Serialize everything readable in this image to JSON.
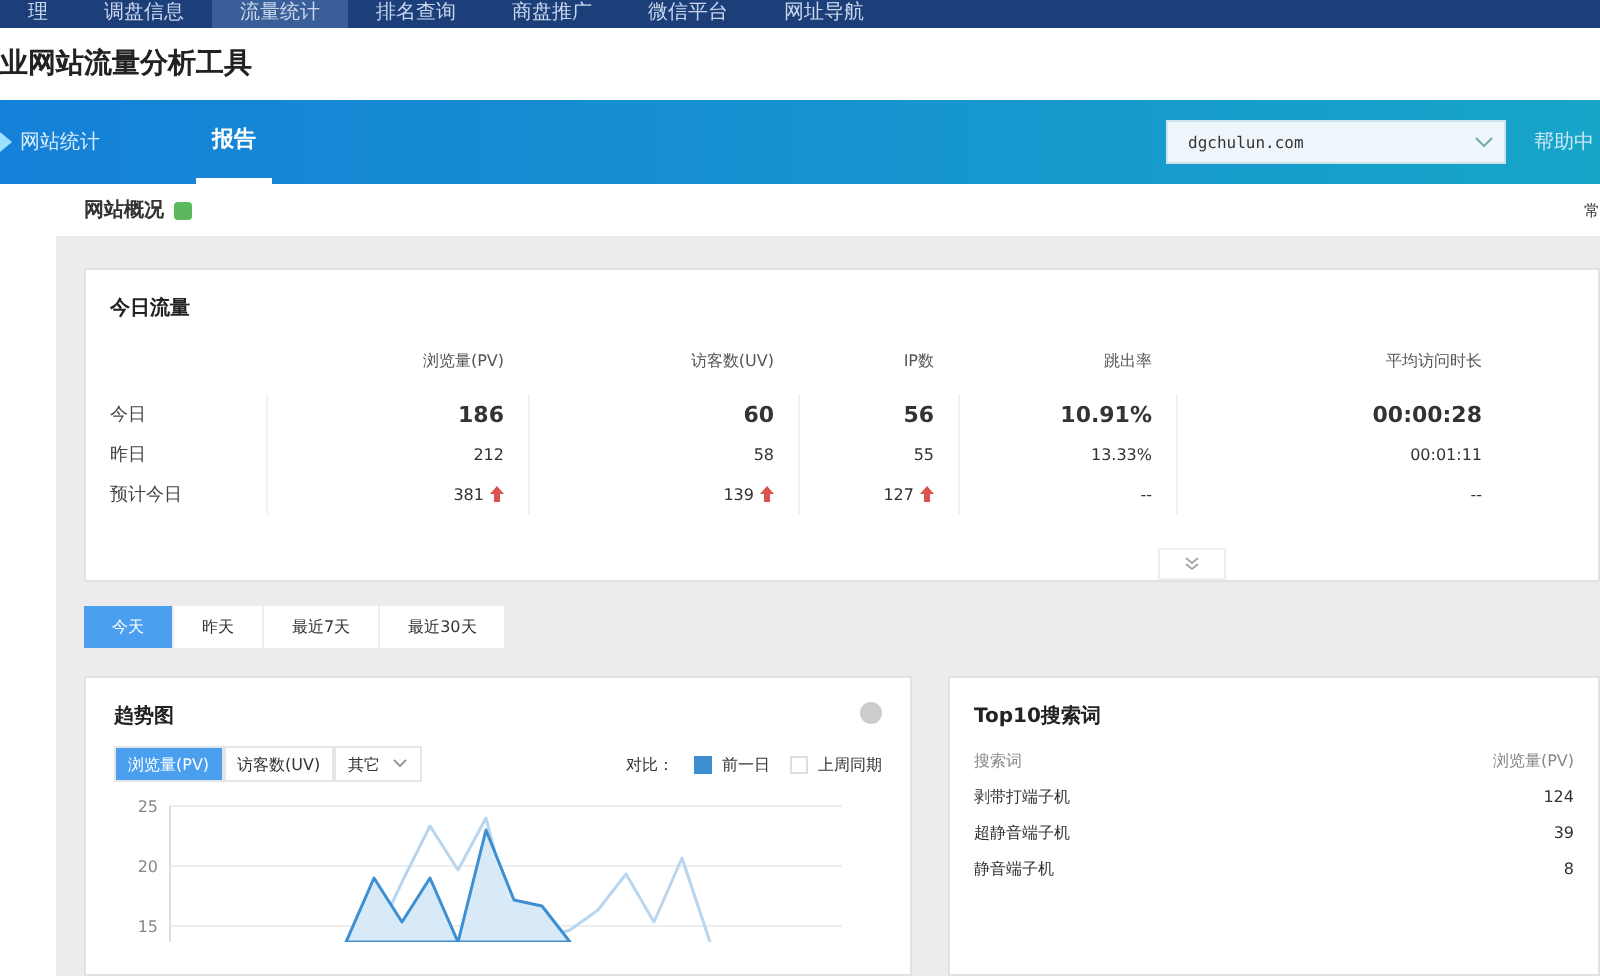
{
  "top_nav": [
    {
      "label": "理",
      "selected": false
    },
    {
      "label": "调盘信息",
      "selected": false
    },
    {
      "label": "流量统计",
      "selected": true
    },
    {
      "label": "排名查询",
      "selected": false
    },
    {
      "label": "商盘推广",
      "selected": false
    },
    {
      "label": "微信平台",
      "selected": false
    },
    {
      "label": "网址导航",
      "selected": false
    }
  ],
  "site_title": "业网站流量分析工具",
  "band": {
    "section": "网站统计",
    "tabs": [
      {
        "label": "报告",
        "selected": true
      }
    ],
    "domain": "dgchulun.com",
    "help": "帮助中"
  },
  "page_header": {
    "title": "网站概况",
    "right": "常"
  },
  "today_traffic": {
    "title": "今日流量",
    "columns": [
      "浏览量(PV)",
      "访客数(UV)",
      "IP数",
      "跳出率",
      "平均访问时长"
    ],
    "rows": [
      {
        "kind": "main",
        "label": "今日",
        "cells": [
          {
            "text": "186",
            "up": false
          },
          {
            "text": "60",
            "up": false
          },
          {
            "text": "56",
            "up": false
          },
          {
            "text": "10.91%",
            "up": false
          },
          {
            "text": "00:00:28",
            "up": false
          }
        ]
      },
      {
        "kind": "plain",
        "label": "昨日",
        "cells": [
          {
            "text": "212",
            "up": false
          },
          {
            "text": "58",
            "up": false
          },
          {
            "text": "55",
            "up": false
          },
          {
            "text": "13.33%",
            "up": false
          },
          {
            "text": "00:01:11",
            "up": false
          }
        ]
      },
      {
        "kind": "plain",
        "label": "预计今日",
        "cells": [
          {
            "text": "381",
            "up": true
          },
          {
            "text": "139",
            "up": true
          },
          {
            "text": "127",
            "up": true
          },
          {
            "text": "--",
            "up": false
          },
          {
            "text": "--",
            "up": false
          }
        ]
      }
    ]
  },
  "date_tabs": [
    {
      "label": "今天",
      "selected": true
    },
    {
      "label": "昨天",
      "selected": false
    },
    {
      "label": "最近7天",
      "selected": false
    },
    {
      "label": "最近30天",
      "selected": false
    }
  ],
  "trend": {
    "title": "趋势图",
    "metric_tabs": [
      {
        "label": "浏览量(PV)",
        "selected": true
      },
      {
        "label": "访客数(UV)",
        "selected": false
      }
    ],
    "other": "其它",
    "compare_label": "对比：",
    "compare": [
      {
        "label": "前一日",
        "checked": true
      },
      {
        "label": "上周同期",
        "checked": false
      }
    ],
    "y_axis_labels": [
      "25",
      "20",
      "15"
    ]
  },
  "top_keywords": {
    "title": "Top10搜索词",
    "columns": [
      "搜索词",
      "浏览量(PV)"
    ],
    "rows": [
      [
        "剥带打端子机",
        "124"
      ],
      [
        "超静音端子机",
        "39"
      ],
      [
        "静音端子机",
        "8"
      ]
    ]
  }
}
